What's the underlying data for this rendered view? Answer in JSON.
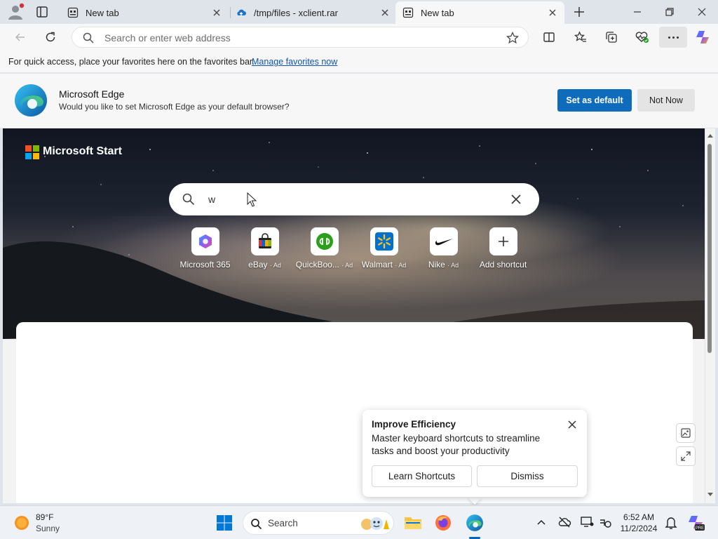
{
  "browser": {
    "tabs": [
      {
        "title": "New tab",
        "icon": "newtab-icon",
        "active": false
      },
      {
        "title": "/tmp/files - xclient.rar",
        "icon": "cloud-icon",
        "active": false
      },
      {
        "title": "New tab",
        "icon": "newtab-icon",
        "active": true
      }
    ],
    "address": {
      "placeholder": "Search or enter web address",
      "value": ""
    }
  },
  "favorites_bar": {
    "message": "For quick access, place your favorites here on the favorites bar.",
    "link": "Manage favorites now"
  },
  "banner": {
    "title": "Microsoft Edge",
    "subtitle": "Would you like to set Microsoft Edge as your default browser?",
    "primary": "Set as default",
    "secondary": "Not Now"
  },
  "start": {
    "brand": "Microsoft Start",
    "search_value": "w",
    "shortcuts": [
      {
        "label": "Microsoft 365",
        "ad": ""
      },
      {
        "label": "eBay",
        "ad": "· Ad"
      },
      {
        "label": "QuickBoo...",
        "ad": "· Ad"
      },
      {
        "label": "Walmart",
        "ad": "· Ad"
      },
      {
        "label": "Nike",
        "ad": "· Ad"
      },
      {
        "label": "Add shortcut",
        "ad": ""
      }
    ]
  },
  "popup": {
    "title": "Improve Efficiency",
    "body": "Master keyboard shortcuts to streamline tasks and boost your productivity",
    "learn": "Learn Shortcuts",
    "dismiss": "Dismiss"
  },
  "taskbar": {
    "weather": {
      "temp": "89°F",
      "condition": "Sunny"
    },
    "search": "Search",
    "time": "6:52 AM",
    "date": "11/2/2024"
  },
  "colors": {
    "accent": "#0f6cbd",
    "chrome": "#dfe4ea",
    "toolbar": "#f7f7f7"
  }
}
